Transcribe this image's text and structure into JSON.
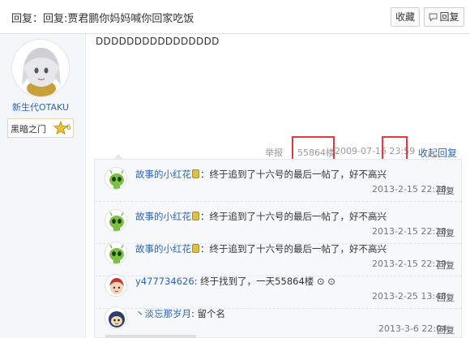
{
  "header": {
    "title": "回复：回复:贾君鹏你妈妈喊你回家吃饭",
    "fav_label": "收藏",
    "reply_label": "回复"
  },
  "author": {
    "name": "新生代OTAKU",
    "level_name": "黑暗之门",
    "level_num": "6"
  },
  "post": {
    "content": "DDDDDDDDDDDDDDDD",
    "report": "举报",
    "floor": "55864楼",
    "time": "2009-07-16 23:59",
    "collapse_label": "收起回复"
  },
  "replies": [
    {
      "user": "故事的小红花",
      "text": "：终于追到了十六号的最后一帖了，好不高兴",
      "time": "2013-2-15 22:28",
      "reply_label": "回复",
      "avatar": "green-alien"
    },
    {
      "user": "故事的小红花",
      "text": "：终于追到了十六号的最后一帖了，好不高兴",
      "time": "2013-2-15 22:28",
      "reply_label": "回复",
      "avatar": "green-alien"
    },
    {
      "user": "故事的小红花",
      "text": "：终于追到了十六号的最后一帖了，好不高兴",
      "time": "2013-2-15 22:29",
      "reply_label": "回复",
      "avatar": "green-alien"
    },
    {
      "user": "y477734626",
      "text": ": 终于找到了，一天55864楼 ⊙ ⊙",
      "time": "2013-2-25 13:48",
      "reply_label": "回复",
      "avatar": "red-hair"
    },
    {
      "user": "丶淡忘那岁月",
      "text": ": 留个名",
      "time": "2013-3-6 22:04",
      "reply_label": "回复",
      "avatar": "cartoon-face"
    }
  ],
  "colors": {
    "link": "#2d64b3",
    "highlight_box": "#e23a3a",
    "sidebar_bg": "#f4f7fa"
  }
}
